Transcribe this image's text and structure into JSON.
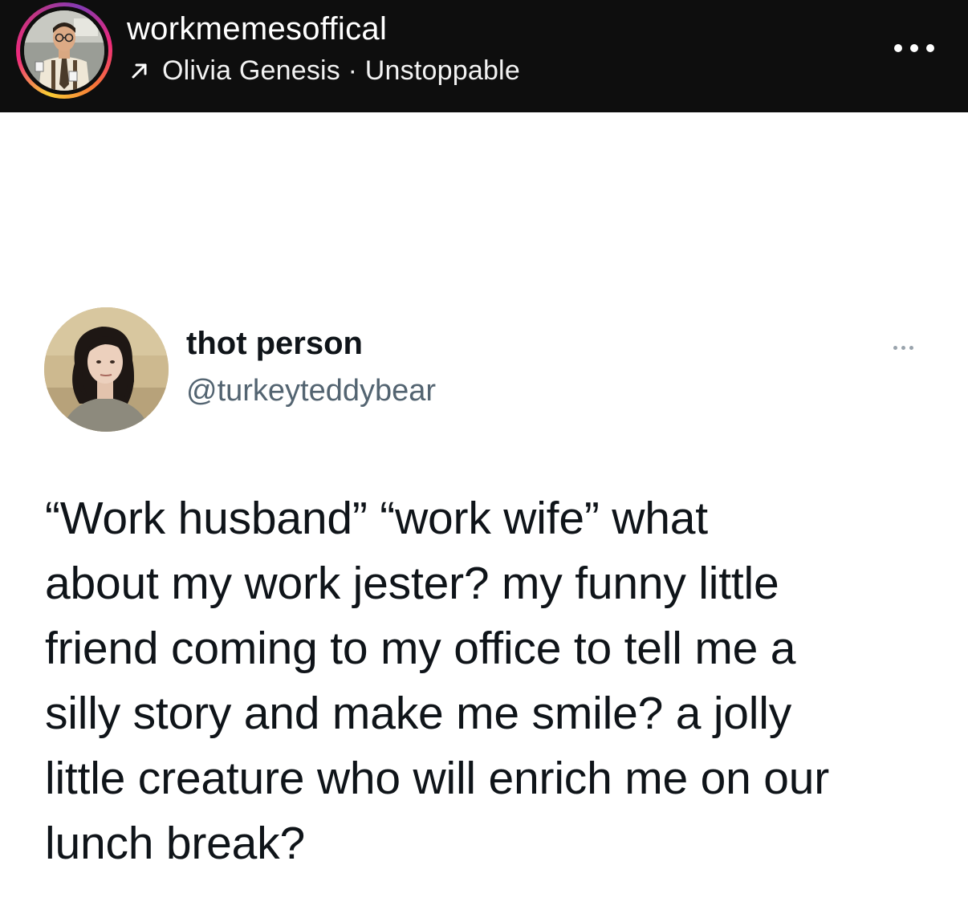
{
  "post_header": {
    "account_name": "workmemesoffical",
    "audio_icon": "trending-arrow-icon",
    "audio_text": "Olivia Genesis · Unstoppable",
    "more_icon": "more-options-icon",
    "ring_colors": [
      "#f9ce34",
      "#ee2a7b",
      "#833ab4"
    ],
    "background": "#0e0e0e"
  },
  "tweet": {
    "display_name": "thot person",
    "handle": "@turkeyteddybear",
    "more_icon": "more-options-icon",
    "text_lines": [
      "“Work husband” “work wife” what",
      "about my work jester? my funny little",
      "friend coming to my office to tell me a",
      "silly story and make me smile? a jolly",
      "little creature who will enrich me on our",
      "lunch break?"
    ],
    "text_color": "#0f1419",
    "handle_color": "#536471"
  }
}
